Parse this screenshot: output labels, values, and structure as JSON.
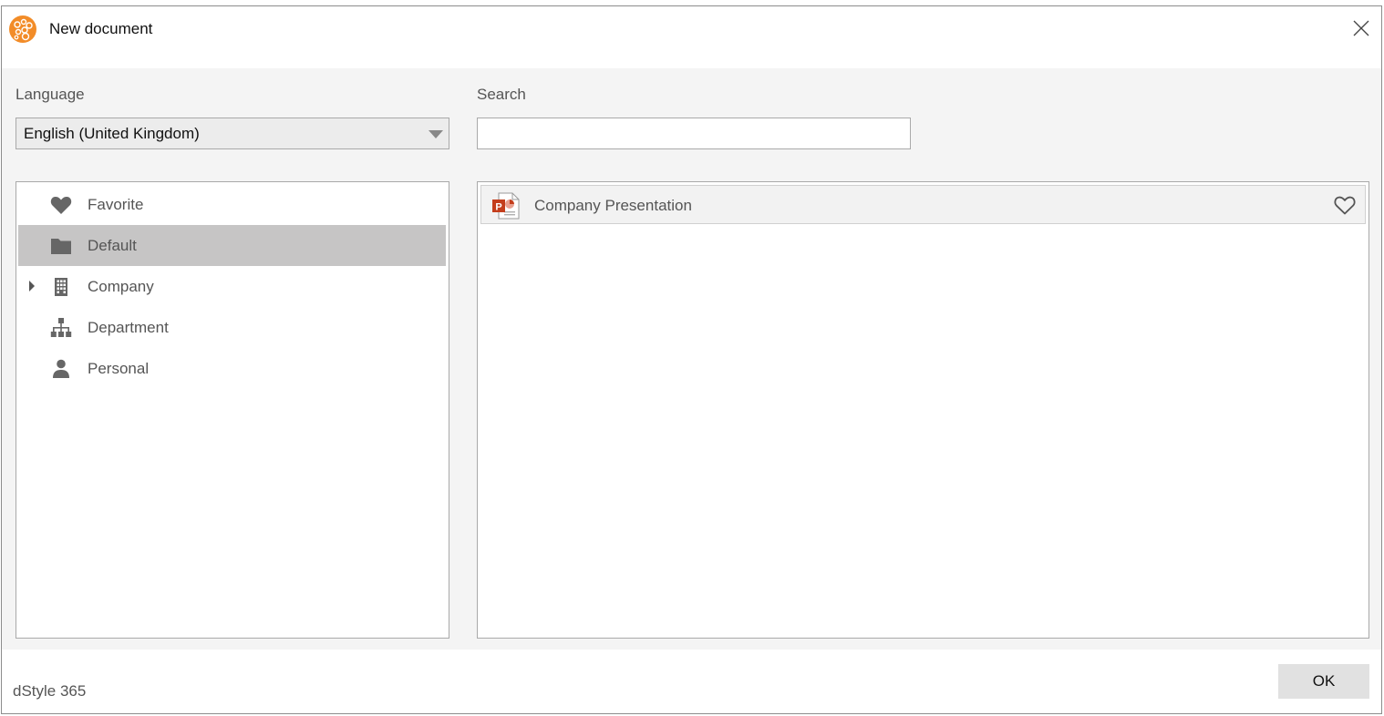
{
  "window": {
    "title": "New document"
  },
  "language": {
    "label": "Language",
    "selected": "English (United Kingdom)"
  },
  "search": {
    "label": "Search",
    "value": "",
    "placeholder": ""
  },
  "tree": {
    "items": [
      {
        "label": "Favorite",
        "icon": "heart-icon",
        "selected": false,
        "expandable": false
      },
      {
        "label": "Default",
        "icon": "folder-icon",
        "selected": true,
        "expandable": false
      },
      {
        "label": "Company",
        "icon": "building-icon",
        "selected": false,
        "expandable": true
      },
      {
        "label": "Department",
        "icon": "org-chart-icon",
        "selected": false,
        "expandable": false
      },
      {
        "label": "Personal",
        "icon": "person-icon",
        "selected": false,
        "expandable": false
      }
    ]
  },
  "documents": {
    "items": [
      {
        "label": "Company Presentation",
        "icon": "powerpoint-icon",
        "favorite": false
      }
    ]
  },
  "footer": {
    "brand": "dStyle 365",
    "ok_label": "OK"
  },
  "colors": {
    "logo": "#f28c28",
    "selected_row": "#c6c5c5",
    "icon_gray": "#666666",
    "ppt_red": "#c43e1c"
  }
}
